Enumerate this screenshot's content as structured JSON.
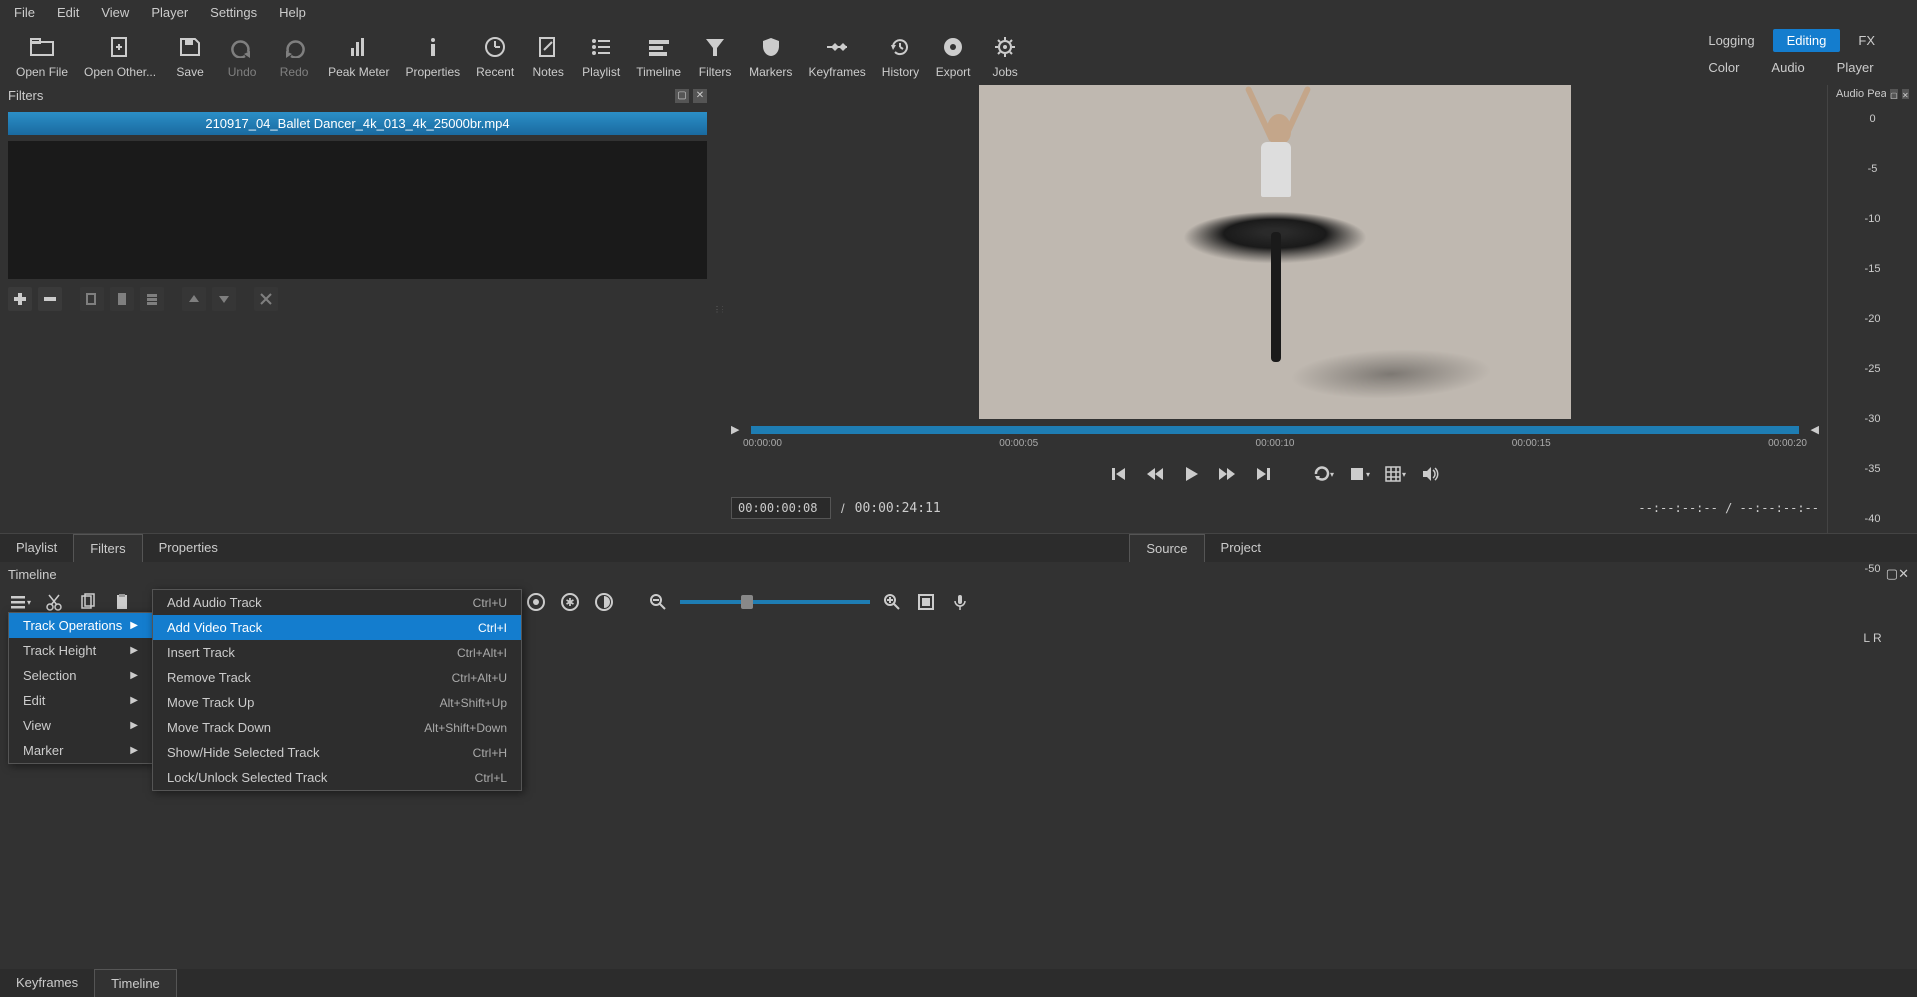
{
  "menubar": [
    "File",
    "Edit",
    "View",
    "Player",
    "Settings",
    "Help"
  ],
  "toolbar": [
    {
      "label": "Open File",
      "icon": "folder"
    },
    {
      "label": "Open Other...",
      "icon": "file-plus"
    },
    {
      "label": "Save",
      "icon": "save"
    },
    {
      "label": "Undo",
      "icon": "undo",
      "disabled": true
    },
    {
      "label": "Redo",
      "icon": "redo",
      "disabled": true
    },
    {
      "label": "Peak Meter",
      "icon": "meter"
    },
    {
      "label": "Properties",
      "icon": "info"
    },
    {
      "label": "Recent",
      "icon": "clock"
    },
    {
      "label": "Notes",
      "icon": "edit-doc"
    },
    {
      "label": "Playlist",
      "icon": "list"
    },
    {
      "label": "Timeline",
      "icon": "timeline"
    },
    {
      "label": "Filters",
      "icon": "funnel"
    },
    {
      "label": "Markers",
      "icon": "shield"
    },
    {
      "label": "Keyframes",
      "icon": "keyframes"
    },
    {
      "label": "History",
      "icon": "history"
    },
    {
      "label": "Export",
      "icon": "disc"
    },
    {
      "label": "Jobs",
      "icon": "gear"
    }
  ],
  "right_tabs": {
    "row1": [
      "Logging",
      "Editing",
      "FX"
    ],
    "row1_active": "Editing",
    "row2": [
      "Color",
      "Audio",
      "Player"
    ]
  },
  "filters_panel": {
    "title": "Filters",
    "clip_name": "210917_04_Ballet Dancer_4k_013_4k_25000br.mp4"
  },
  "preview": {
    "time_marks": [
      "00:00:00",
      "00:00:05",
      "00:00:10",
      "00:00:15",
      "00:00:20"
    ],
    "current_time": "00:00:00:08",
    "duration": "00:00:24:11",
    "in_out_display": "--:--:--:--  /  --:--:--:--"
  },
  "peak_panel": {
    "title": "Audio Peak ...",
    "scale": [
      "0",
      "-5",
      "-10",
      "-15",
      "-20",
      "-25",
      "-30",
      "-35",
      "-40",
      "-50"
    ],
    "channels": "L  R"
  },
  "bottom_left_tabs": [
    "Playlist",
    "Filters",
    "Properties"
  ],
  "bottom_left_active": "Filters",
  "bottom_right_tabs": [
    "Source",
    "Project"
  ],
  "bottom_right_active": "Source",
  "timeline": {
    "title": "Timeline"
  },
  "context_menu": {
    "items": [
      {
        "label": "Track Operations",
        "submenu": true,
        "highlighted": true
      },
      {
        "label": "Track Height",
        "submenu": true
      },
      {
        "label": "Selection",
        "submenu": true
      },
      {
        "label": "Edit",
        "submenu": true
      },
      {
        "label": "View",
        "submenu": true
      },
      {
        "label": "Marker",
        "submenu": true
      }
    ],
    "submenu": [
      {
        "label": "Add Audio Track",
        "shortcut": "Ctrl+U"
      },
      {
        "label": "Add Video Track",
        "shortcut": "Ctrl+I",
        "highlighted": true
      },
      {
        "label": "Insert Track",
        "shortcut": "Ctrl+Alt+I"
      },
      {
        "label": "Remove Track",
        "shortcut": "Ctrl+Alt+U"
      },
      {
        "label": "Move Track Up",
        "shortcut": "Alt+Shift+Up"
      },
      {
        "label": "Move Track Down",
        "shortcut": "Alt+Shift+Down"
      },
      {
        "label": "Show/Hide Selected Track",
        "shortcut": "Ctrl+H"
      },
      {
        "label": "Lock/Unlock Selected Track",
        "shortcut": "Ctrl+L"
      }
    ]
  },
  "footer_tabs": [
    "Keyframes",
    "Timeline"
  ],
  "footer_active": "Timeline"
}
